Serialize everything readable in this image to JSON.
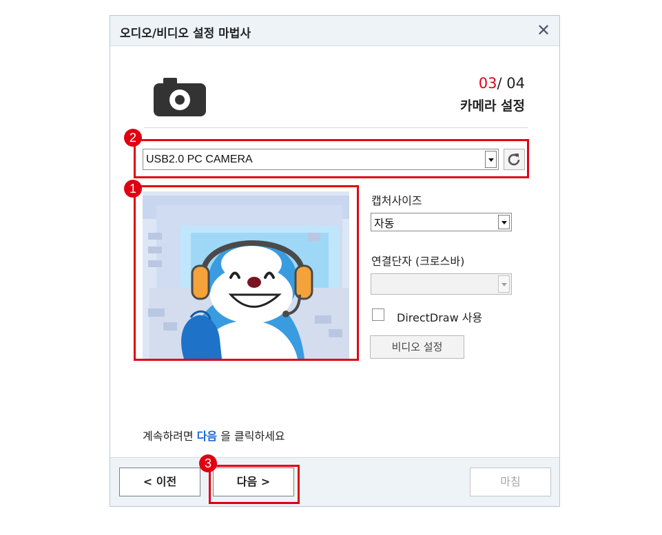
{
  "dialog": {
    "title": "오디오/비디오 설정 마법사",
    "close_icon": "close-icon"
  },
  "header": {
    "icon": "camera-icon",
    "step_current": "03",
    "step_total": "/ 04",
    "step_title": "카메라 설정"
  },
  "camera": {
    "selected": "USB2.0 PC CAMERA",
    "refresh_icon": "refresh-icon"
  },
  "settings": {
    "capture_size_label": "캡처사이즈",
    "capture_size_value": "자동",
    "crossbar_label": "연결단자 (크로스바)",
    "crossbar_value": "",
    "directdraw_label": "DirectDraw 사용",
    "directdraw_checked": false,
    "video_settings_label": "비디오 설정"
  },
  "hint": {
    "before": "계속하려면 ",
    "emphasis": "다음",
    "after": " 을 클릭하세요"
  },
  "footer": {
    "prev_label": "< 이전",
    "next_label": "다음 >",
    "finish_label": "마침"
  },
  "annotations": [
    "1",
    "2",
    "3"
  ],
  "colors": {
    "accent_red": "#e00010",
    "step_red": "#e0001a",
    "link_blue": "#1a66d8",
    "header_bg": "#eef3f8"
  }
}
